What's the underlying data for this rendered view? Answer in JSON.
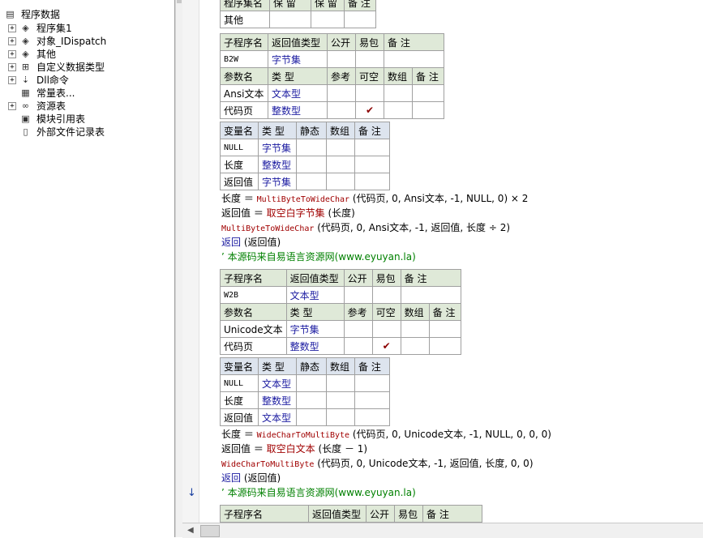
{
  "tree": {
    "root": "程序数据",
    "items": [
      {
        "label": "程序集1",
        "icon": "assembly-icon",
        "expander": "+"
      },
      {
        "label": "对象_IDispatch",
        "icon": "assembly-icon",
        "expander": "+"
      },
      {
        "label": "其他",
        "icon": "assembly-icon",
        "expander": "+"
      },
      {
        "label": "自定义数据类型",
        "icon": "datatype-icon",
        "expander": "+"
      },
      {
        "label": "Dll命令",
        "icon": "dll-icon",
        "expander": "+"
      },
      {
        "label": "常量表...",
        "icon": "constant-icon",
        "expander": ""
      },
      {
        "label": "资源表",
        "icon": "resource-icon",
        "expander": "+"
      },
      {
        "label": "模块引用表",
        "icon": "module-icon",
        "expander": ""
      },
      {
        "label": "外部文件记录表",
        "icon": "file-icon",
        "expander": ""
      }
    ]
  },
  "top_partial": {
    "header": [
      "程序集名",
      "保 留",
      "保 留",
      "备 注"
    ],
    "row": [
      "其他",
      "",
      "",
      ""
    ]
  },
  "sub1": {
    "header": [
      "子程序名",
      "返回值类型",
      "公开",
      "易包",
      "备 注"
    ],
    "row": [
      "B2W",
      "字节集",
      "",
      "",
      ""
    ],
    "param_header": [
      "参数名",
      "类 型",
      "参考",
      "可空",
      "数组",
      "备 注"
    ],
    "params": [
      [
        "Ansi文本",
        "文本型",
        "",
        "",
        "",
        ""
      ],
      [
        "代码页",
        "整数型",
        "",
        "✔",
        "",
        ""
      ]
    ]
  },
  "vars1": {
    "header": [
      "变量名",
      "类 型",
      "静态",
      "数组",
      "备 注"
    ],
    "rows": [
      [
        "NULL",
        "字节集",
        "",
        "",
        ""
      ],
      [
        "长度",
        "整数型",
        "",
        "",
        ""
      ],
      [
        "返回值",
        "字节集",
        "",
        "",
        ""
      ]
    ]
  },
  "code1": {
    "line1": {
      "a": "长度 ＝ ",
      "b": "MultiByteToWideChar",
      "c": " (代码页, 0, Ansi文本, -1, NULL, 0) × 2"
    },
    "line2": {
      "a": "返回值 ＝ ",
      "b": "取空白字节集",
      "c": " (长度)"
    },
    "line3": {
      "a": "MultiByteToWideChar",
      "b": " (代码页, 0, Ansi文本, -1, 返回值, 长度 ÷ 2)"
    },
    "line4": {
      "a": "返回",
      "b": " (返回值)"
    },
    "line5": "’ 本源码来自易语言资源网(www.eyuyan.la)"
  },
  "sub2": {
    "header": [
      "子程序名",
      "返回值类型",
      "公开",
      "易包",
      "备 注"
    ],
    "row": [
      "W2B",
      "文本型",
      "",
      "",
      ""
    ],
    "param_header": [
      "参数名",
      "类 型",
      "参考",
      "可空",
      "数组",
      "备 注"
    ],
    "params": [
      [
        "Unicode文本",
        "字节集",
        "",
        "",
        "",
        ""
      ],
      [
        "代码页",
        "整数型",
        "",
        "✔",
        "",
        ""
      ]
    ]
  },
  "vars2": {
    "header": [
      "变量名",
      "类 型",
      "静态",
      "数组",
      "备 注"
    ],
    "rows": [
      [
        "NULL",
        "文本型",
        "",
        "",
        ""
      ],
      [
        "长度",
        "整数型",
        "",
        "",
        ""
      ],
      [
        "返回值",
        "文本型",
        "",
        "",
        ""
      ]
    ]
  },
  "code2": {
    "line1": {
      "a": "长度 ＝ ",
      "b": "WideCharToMultiByte",
      "c": " (代码页, 0, Unicode文本, -1, NULL, 0, 0, 0)"
    },
    "line2": {
      "a": "返回值 ＝ ",
      "b": "取空白文本",
      "c": " (长度 － 1)"
    },
    "line3": {
      "a": "WideCharToMultiByte",
      "b": " (代码页, 0, Unicode文本, -1, 返回值, 长度, 0, 0)"
    },
    "line4": {
      "a": "返回",
      "b": " (返回值)"
    },
    "line5": "’ 本源码来自易语言资源网(www.eyuyan.la)"
  },
  "sub3": {
    "header": [
      "子程序名",
      "返回值类型",
      "公开",
      "易包",
      "备 注"
    ]
  },
  "colors": {
    "comment": "#008000",
    "type": "#1a1aa0",
    "func": "#a00000",
    "header_green": "#dfe9d8",
    "header_blue": "#dde4ee"
  }
}
